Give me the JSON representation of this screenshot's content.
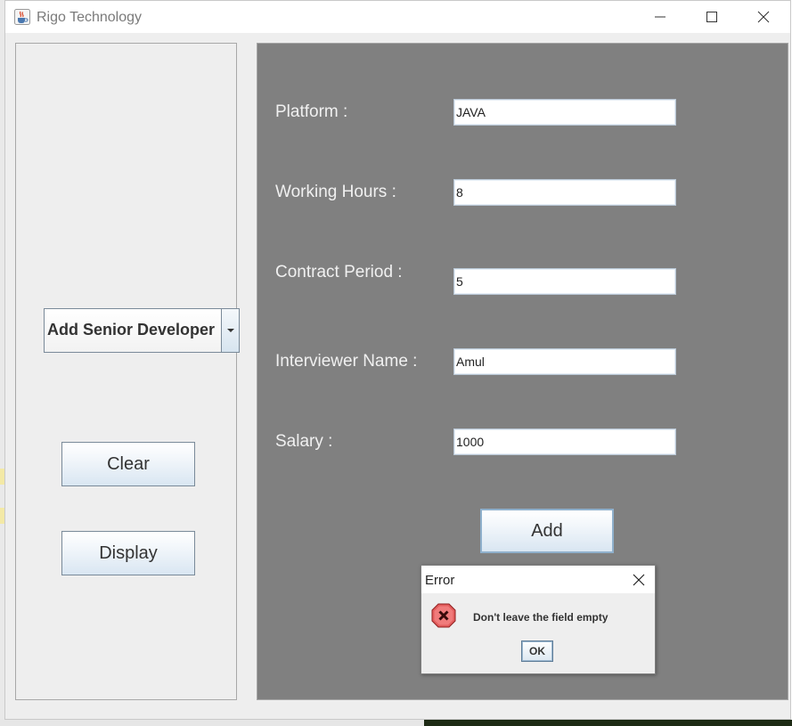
{
  "window": {
    "title": "Rigo Technology",
    "icon": "java-coffee-icon"
  },
  "left_panel": {
    "combo": {
      "selected": "Add Senior Developer",
      "icon": "chevron-down-icon"
    },
    "buttons": {
      "clear": "Clear",
      "display": "Display"
    }
  },
  "form": {
    "fields": [
      {
        "label": "Platform :",
        "value": "JAVA"
      },
      {
        "label": "Working Hours :",
        "value": "8"
      },
      {
        "label": "Contract Period :",
        "value": "5"
      },
      {
        "label": "Interviewer Name :",
        "value": "Amul"
      },
      {
        "label": "Salary :",
        "value": "1000"
      }
    ],
    "add_label": "Add"
  },
  "dialog": {
    "title": "Error",
    "message": "Don't leave the field empty",
    "ok_label": "OK",
    "icon": "error-x-icon"
  },
  "colors": {
    "panel_gray": "#808080",
    "error_red": "#d93a3a",
    "button_blue": "#d9e6f2"
  }
}
